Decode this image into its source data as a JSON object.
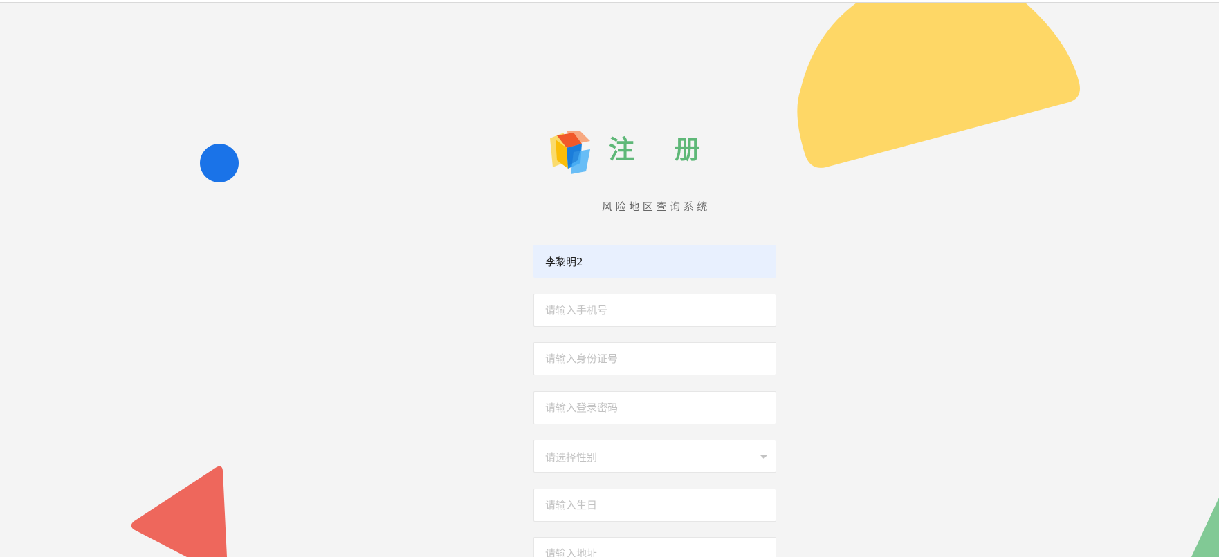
{
  "header": {
    "title": "注册",
    "subtitle": "风险地区查询系统"
  },
  "form": {
    "name": {
      "value": "李黎明2",
      "placeholder": ""
    },
    "phone": {
      "value": "",
      "placeholder": "请输入手机号"
    },
    "id_card": {
      "value": "",
      "placeholder": "请输入身份证号"
    },
    "password": {
      "value": "",
      "placeholder": "请输入登录密码"
    },
    "gender": {
      "selected": "",
      "placeholder": "请选择性别",
      "options": []
    },
    "birthday": {
      "value": "",
      "placeholder": "请输入生日"
    },
    "address": {
      "value": "",
      "placeholder": "请输入地址"
    }
  },
  "icons": {
    "logo": "cube-logo-icon",
    "dropdown": "chevron-down-icon"
  },
  "colors": {
    "background": "#f4f4f4",
    "title_green": "#5fb878",
    "filled_input": "#e8f0fe",
    "deco_yellow": "#fed766",
    "deco_blue": "#1a73e8",
    "deco_red": "#ee675c",
    "deco_green": "#81c995"
  }
}
